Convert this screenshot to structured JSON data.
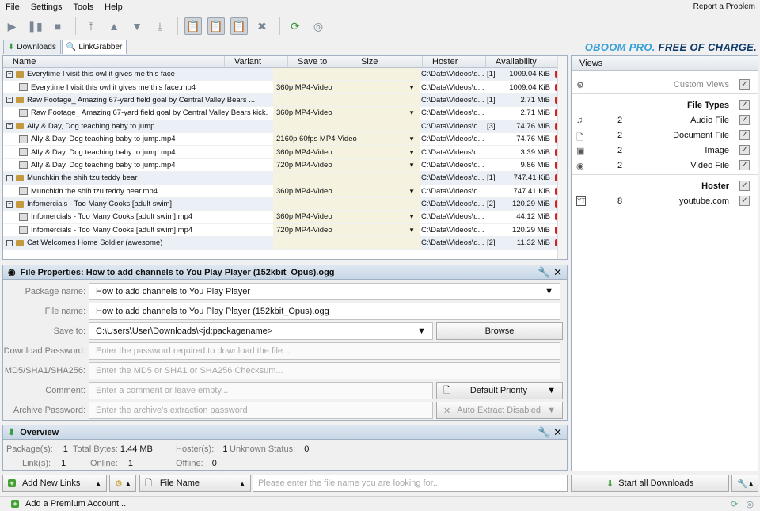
{
  "menu": {
    "items": [
      "File",
      "Settings",
      "Tools",
      "Help"
    ],
    "report": "Report a Problem"
  },
  "tabs": [
    {
      "label": "Downloads"
    },
    {
      "label": "LinkGrabber"
    }
  ],
  "banner": {
    "brand": "OBOOM",
    "pro": "PRO.",
    "tag": "FREE OF CHARGE."
  },
  "table": {
    "headers": [
      "Name",
      "Variant",
      "Save to",
      "Size",
      "Hoster",
      "Availability"
    ],
    "rows": [
      {
        "kind": "pkg",
        "name": "Everytime I visit this owl it gives me this face",
        "variant": "",
        "save": "C:\\Data\\Videos\\d...",
        "cnt": "[1]",
        "size": "1009.04 KiB"
      },
      {
        "kind": "file",
        "name": "Everytime I visit this owl it gives me this face.mp4",
        "variant": "360p MP4-Video",
        "save": "C:\\Data\\Videos\\d...",
        "cnt": "",
        "size": "1009.04 KiB"
      },
      {
        "kind": "pkg",
        "name": "Raw Footage_ Amazing 67-yard field goal by Central Valley Bears ...",
        "variant": "",
        "save": "C:\\Data\\Videos\\d...",
        "cnt": "[1]",
        "size": "2.71 MiB"
      },
      {
        "kind": "file",
        "name": "Raw Footage_ Amazing 67-yard field goal by Central Valley Bears kick.",
        "variant": "360p MP4-Video",
        "save": "C:\\Data\\Videos\\d...",
        "cnt": "",
        "size": "2.71 MiB"
      },
      {
        "kind": "pkg",
        "name": "Ally & Day, Dog teaching baby to jump",
        "variant": "",
        "save": "C:\\Data\\Videos\\d...",
        "cnt": "[3]",
        "size": "74.76 MiB"
      },
      {
        "kind": "file",
        "name": "Ally & Day, Dog teaching baby to jump.mp4",
        "variant": "2160p 60fps MP4-Video",
        "save": "C:\\Data\\Videos\\d...",
        "cnt": "",
        "size": "74.76 MiB"
      },
      {
        "kind": "file",
        "name": "Ally & Day, Dog teaching baby to jump.mp4",
        "variant": "360p MP4-Video",
        "save": "C:\\Data\\Videos\\d...",
        "cnt": "",
        "size": "3.39 MiB"
      },
      {
        "kind": "file",
        "name": "Ally & Day, Dog teaching baby to jump.mp4",
        "variant": "720p MP4-Video",
        "save": "C:\\Data\\Videos\\d...",
        "cnt": "",
        "size": "9.86 MiB"
      },
      {
        "kind": "pkg",
        "name": "Munchkin the shih tzu teddy bear",
        "variant": "",
        "save": "C:\\Data\\Videos\\d...",
        "cnt": "[1]",
        "size": "747.41 KiB"
      },
      {
        "kind": "file",
        "name": "Munchkin the shih tzu teddy bear.mp4",
        "variant": "360p MP4-Video",
        "save": "C:\\Data\\Videos\\d...",
        "cnt": "",
        "size": "747.41 KiB"
      },
      {
        "kind": "pkg",
        "name": "Infomercials - Too Many Cooks [adult swim]",
        "variant": "",
        "save": "C:\\Data\\Videos\\d...",
        "cnt": "[2]",
        "size": "120.29 MiB"
      },
      {
        "kind": "file",
        "name": "Infomercials - Too Many Cooks [adult swim].mp4",
        "variant": "360p MP4-Video",
        "save": "C:\\Data\\Videos\\d...",
        "cnt": "",
        "size": "44.12 MiB"
      },
      {
        "kind": "file",
        "name": "Infomercials - Too Many Cooks [adult swim].mp4",
        "variant": "720p MP4-Video",
        "save": "C:\\Data\\Videos\\d...",
        "cnt": "",
        "size": "120.29 MiB"
      },
      {
        "kind": "pkg",
        "name": "Cat Welcomes Home Soldier (awesome)",
        "variant": "",
        "save": "C:\\Data\\Videos\\d...",
        "cnt": "[2]",
        "size": "11.32 MiB"
      }
    ]
  },
  "views": {
    "header": "Views",
    "custom": "Custom Views",
    "filetypes": "File Types",
    "types": [
      {
        "count": "2",
        "label": "Audio File"
      },
      {
        "count": "2",
        "label": "Document File"
      },
      {
        "count": "2",
        "label": "Image"
      },
      {
        "count": "2",
        "label": "Video File"
      }
    ],
    "hoster": "Hoster",
    "hosters": [
      {
        "count": "8",
        "label": "youtube.com"
      }
    ]
  },
  "props": {
    "title": "File Properties: How to add channels to You Play Player (152kbit_Opus).ogg",
    "package_label": "Package name:",
    "package_value": "How to add channels to You Play Player",
    "file_label": "File name:",
    "file_value": "How to add channels to You Play Player (152kbit_Opus).ogg",
    "save_label": "Save to:",
    "save_value": "C:\\Users\\User\\Downloads\\<jd:packagename>",
    "browse": "Browse",
    "pw_label": "Download Password:",
    "pw_ph": "Enter the password required to download the file...",
    "md5_label": "MD5/SHA1/SHA256:",
    "md5_ph": "Enter the MD5 or SHA1 or SHA256 Checksum...",
    "comment_label": "Comment:",
    "comment_ph": "Enter a comment or leave empty...",
    "priority": "Default Priority",
    "archive_label": "Archive Password:",
    "archive_ph": "Enter the archive's extraction password",
    "autoextract": "Auto Extract Disabled"
  },
  "overview": {
    "title": "Overview",
    "packages_l": "Package(s):",
    "packages": "1",
    "bytes_l": "Total Bytes:",
    "bytes": "1.44 MB",
    "hosters_l": "Hoster(s):",
    "hosters": "1",
    "unknown_l": "Unknown Status:",
    "unknown": "0",
    "links_l": "Link(s):",
    "links": "1",
    "online_l": "Online:",
    "online": "1",
    "offline_l": "Offline:",
    "offline": "0"
  },
  "bottom": {
    "add": "Add New Links",
    "filter": "File Name",
    "search_ph": "Please enter the file name you are looking for...",
    "start": "Start all Downloads"
  },
  "status": {
    "premium": "Add a Premium Account..."
  }
}
